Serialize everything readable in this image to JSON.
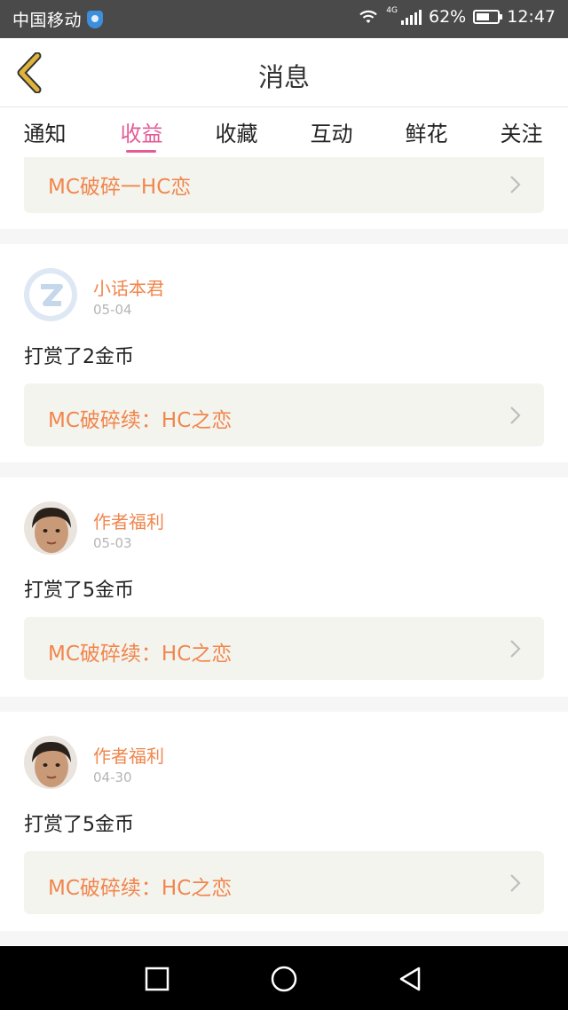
{
  "status_bar": {
    "carrier": "中国移动",
    "network": "4G",
    "battery": "62%",
    "battery_level": 0.62,
    "time": "12:47"
  },
  "header": {
    "title": "消息"
  },
  "tabs": [
    {
      "label": "通知"
    },
    {
      "label": "收益"
    },
    {
      "label": "收藏"
    },
    {
      "label": "互动"
    },
    {
      "label": "鲜花"
    },
    {
      "label": "关注"
    }
  ],
  "active_tab": 1,
  "top_card": {
    "book": "MC破碎一HC恋"
  },
  "items": [
    {
      "user": "小话本君",
      "date": "05-04",
      "text": "打赏了2金币",
      "book": "MC破碎续：HC之恋",
      "avatar": "default-avatar-icon"
    },
    {
      "user": "作者福利",
      "date": "05-03",
      "text": "打赏了5金币",
      "book": "MC破碎续：HC之恋",
      "avatar": "user-photo"
    },
    {
      "user": "作者福利",
      "date": "04-30",
      "text": "打赏了5金币",
      "book": "MC破碎续：HC之恋",
      "avatar": "user-photo"
    }
  ],
  "colors": {
    "accent": "#e45c96",
    "book_text": "#f0864d",
    "card_bg": "#f4f4ee",
    "back_icon": "#e0b43a"
  }
}
